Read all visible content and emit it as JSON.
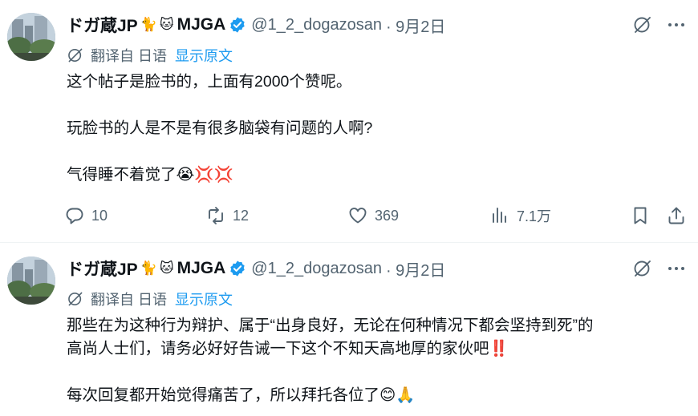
{
  "colors": {
    "accent": "#1d9bf0",
    "secondary_text": "#536471",
    "primary_text": "#0f1419",
    "divider": "#eff3f4"
  },
  "tweets": [
    {
      "author_name": "ドガ蔵JP",
      "name_emojis": [
        "🐈",
        "🐱"
      ],
      "author_suffix": "MJGA",
      "handle": "@1_2_dogazosan",
      "date": "· 9月2日",
      "translated_from": "翻译自 日语",
      "show_original": "显示原文",
      "body": [
        "这个帖子是脸书的，上面有2000个赞呢。",
        "",
        "玩脸书的人是不是有很多脑袋有问题的人啊?",
        "",
        "气得睡不着觉了😭💢💢"
      ],
      "stats": {
        "replies": "10",
        "reposts": "12",
        "likes": "369",
        "views": "7.1万"
      }
    },
    {
      "author_name": "ドガ蔵JP",
      "name_emojis": [
        "🐈",
        "🐱"
      ],
      "author_suffix": "MJGA",
      "handle": "@1_2_dogazosan",
      "date": "· 9月2日",
      "translated_from": "翻译自 日语",
      "show_original": "显示原文",
      "body": [
        "那些在为这种行为辩护、属于“出身良好，无论在何种情况下都会坚持到死”的",
        "高尚人士们，请务必好好告诫一下这个不知天高地厚的家伙吧‼️",
        "",
        "每次回复都开始觉得痛苦了，所以拜托各位了😊🙏"
      ]
    }
  ],
  "icons": [
    "grok-icon",
    "more-icon",
    "translate-icon",
    "verified-badge-icon",
    "reply-icon",
    "repost-icon",
    "like-icon",
    "views-icon",
    "bookmark-icon",
    "share-icon"
  ]
}
